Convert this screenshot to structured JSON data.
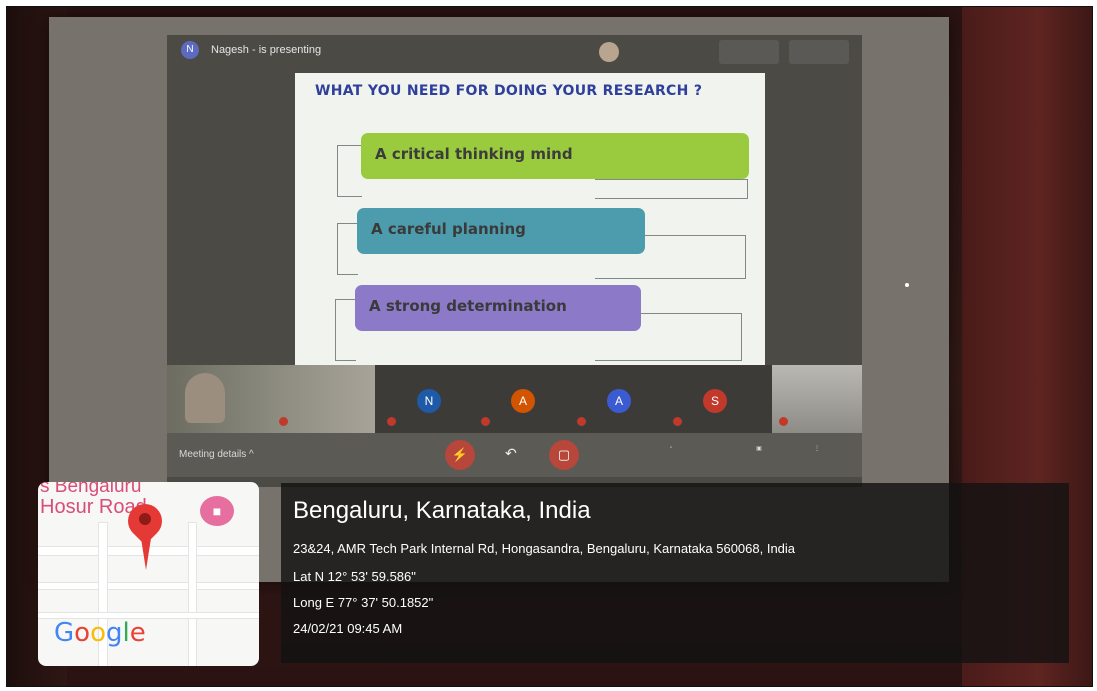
{
  "meeting": {
    "presenter_initial": "N",
    "presenter_text": "Nagesh - is presenting",
    "meeting_details_label": "Meeting details ^"
  },
  "slide": {
    "title": "WHAT  YOU NEED FOR DOING YOUR RESEARCH  ?",
    "items": [
      {
        "label": "A critical thinking mind",
        "color": "#9acb3f"
      },
      {
        "label": "A careful planning",
        "color": "#4d9cad"
      },
      {
        "label": "A strong determination",
        "color": "#8c79c8"
      }
    ]
  },
  "participants": [
    {
      "initial": "N",
      "color": "#1e5aa8"
    },
    {
      "initial": "A",
      "color": "#d35400"
    },
    {
      "initial": "A",
      "color": "#3b5bd1"
    },
    {
      "initial": "S",
      "color": "#c0392b"
    }
  ],
  "map": {
    "label_line1": "s Bengaluru",
    "label_line2": "Hosur Road",
    "logo": "Google",
    "pin_icon": "map-pin-icon",
    "hotel_icon": "hotel-icon"
  },
  "location": {
    "city": "Bengaluru, Karnataka, India",
    "address": "23&24, AMR Tech Park Internal Rd, Hongasandra, Bengaluru, Karnataka 560068, India",
    "lat": "Lat N 12° 53' 59.586\"",
    "long": "Long E 77° 37' 50.1852\"",
    "datetime": "24/02/21 09:45 AM"
  }
}
